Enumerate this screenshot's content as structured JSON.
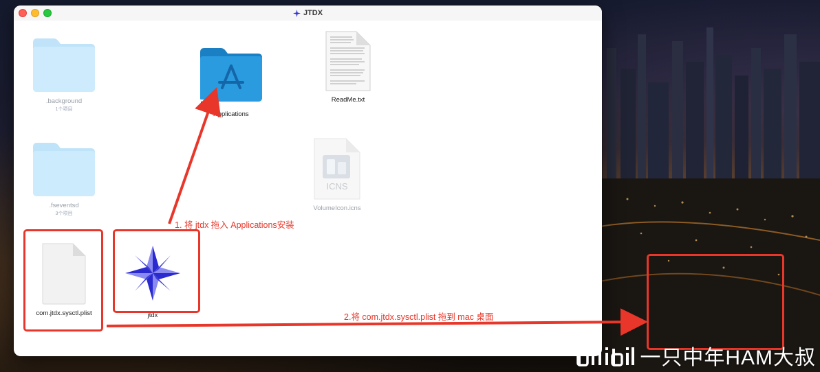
{
  "window": {
    "title": "JTDX"
  },
  "files": [
    {
      "id": "background",
      "label": ".background",
      "sublabel": "1个项目"
    },
    {
      "id": "fseventsd",
      "label": ".fseventsd",
      "sublabel": "3个项目"
    },
    {
      "id": "plist",
      "label": "com.jtdx.sysctl.plist"
    },
    {
      "id": "applications",
      "label": "Applications"
    },
    {
      "id": "jtdx",
      "label": "jtdx"
    },
    {
      "id": "readme",
      "label": "ReadMe.txt"
    },
    {
      "id": "volumeicon",
      "label": "VolumeIcon.icns",
      "icon_text": "ICNS"
    }
  ],
  "annotations": {
    "step1": "1. 将 jtdx 拖入 Applications安装",
    "step2": "2.将 com.jtdx.sysctl.plist 拖到 mac 桌面"
  },
  "watermark": {
    "text": "一只中年HAM大叔",
    "logo": "bilibili-logo"
  },
  "colors": {
    "annotation_red": "#e8372a",
    "folder_blue": "#6cc4f4",
    "applications_blue": "#1e8fd6",
    "jtdx_star_blue": "#2222cc"
  }
}
